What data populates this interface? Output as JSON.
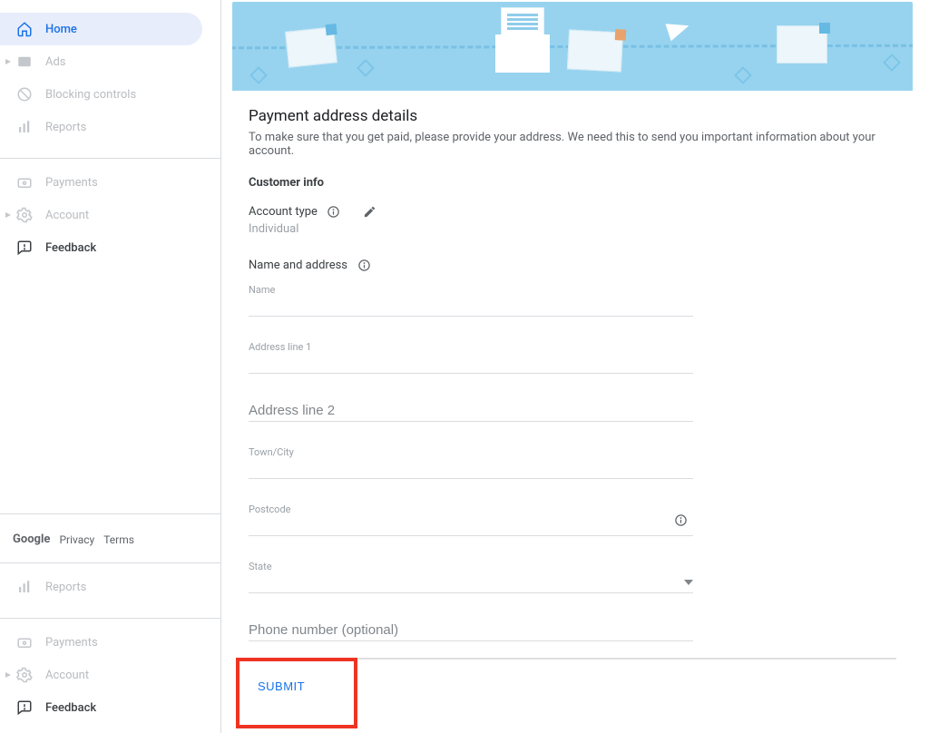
{
  "sidebar": {
    "items": [
      {
        "label": "Home"
      },
      {
        "label": "Ads"
      },
      {
        "label": "Blocking controls"
      },
      {
        "label": "Reports"
      },
      {
        "label": "Payments"
      },
      {
        "label": "Account"
      },
      {
        "label": "Feedback"
      },
      {
        "label": "Reports"
      },
      {
        "label": "Payments"
      },
      {
        "label": "Account"
      },
      {
        "label": "Feedback"
      }
    ],
    "footer": {
      "google": "Google",
      "privacy": "Privacy",
      "terms": "Terms"
    }
  },
  "main": {
    "title": "Payment address details",
    "description": "To make sure that you get paid, please provide your address. We need this to send you important information about your account.",
    "customer_info_heading": "Customer info",
    "account_type": {
      "label": "Account type",
      "value": "Individual"
    },
    "name_address_heading": "Name and address",
    "fields": {
      "name": {
        "label": "Name",
        "value": ""
      },
      "address1": {
        "label": "Address line 1",
        "value": ""
      },
      "address2": {
        "placeholder": "Address line 2",
        "value": ""
      },
      "town": {
        "label": "Town/City",
        "value": ""
      },
      "postcode": {
        "label": "Postcode",
        "value": ""
      },
      "state": {
        "label": "State",
        "value": ""
      },
      "phone": {
        "placeholder": "Phone number (optional)",
        "value": ""
      }
    },
    "submit_label": "SUBMIT"
  }
}
